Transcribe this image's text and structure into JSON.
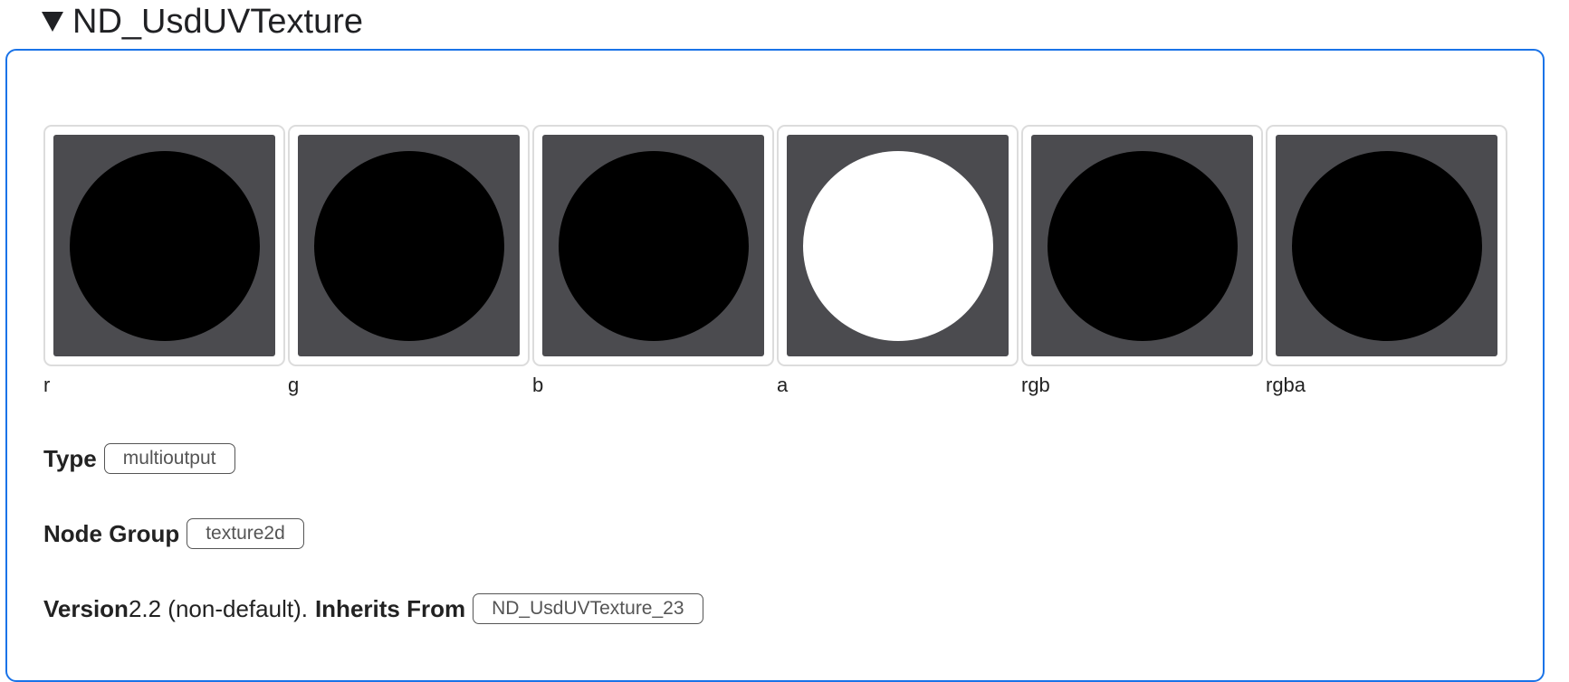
{
  "header": {
    "title": "ND_UsdUVTexture"
  },
  "outputs": [
    {
      "label": "r",
      "disc_color": "#000000"
    },
    {
      "label": "g",
      "disc_color": "#000000"
    },
    {
      "label": "b",
      "disc_color": "#000000"
    },
    {
      "label": "a",
      "disc_color": "#ffffff"
    },
    {
      "label": "rgb",
      "disc_color": "#000000"
    },
    {
      "label": "rgba",
      "disc_color": "#000000"
    }
  ],
  "meta": {
    "type_label": "Type",
    "type_value": "multioutput",
    "node_group_label": "Node Group",
    "node_group_value": "texture2d",
    "version_label": "Version",
    "version_value": "2.2 (non-default).",
    "inherits_label": "Inherits From",
    "inherits_value": "ND_UsdUVTexture_23"
  },
  "colors": {
    "accent_border": "#1a73e8",
    "swatch_background": "#4b4b4f",
    "tile_border": "#dcdcdc"
  }
}
